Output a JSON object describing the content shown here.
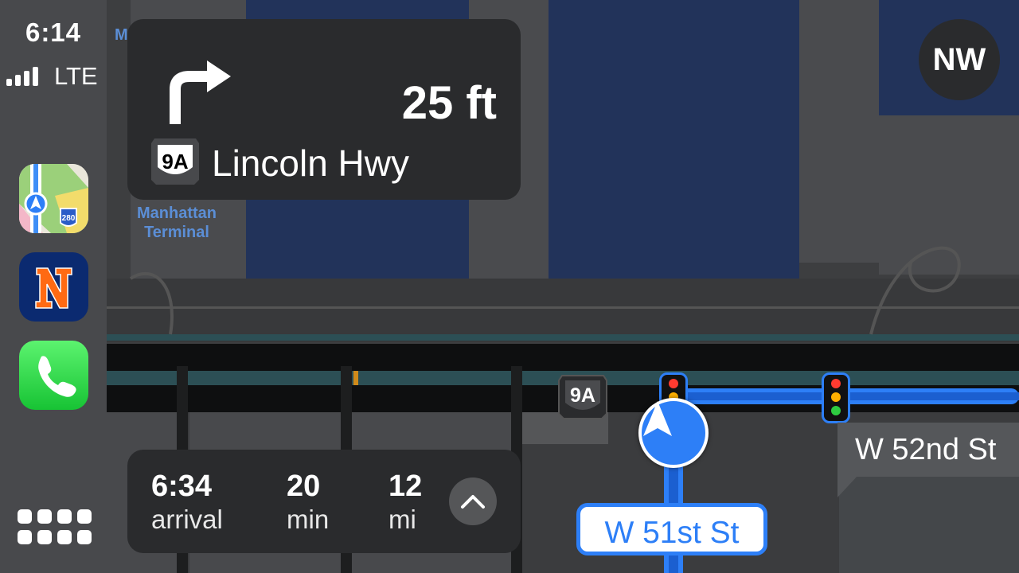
{
  "status_bar": {
    "time": "6:14",
    "network": "LTE",
    "signal_bars": 4
  },
  "dock": {
    "apps": [
      {
        "name": "Maps",
        "badge": "280"
      },
      {
        "name": "Mets"
      },
      {
        "name": "Phone"
      }
    ]
  },
  "maneuver": {
    "distance": "25 ft",
    "route_shield": "9A",
    "road": "Lincoln Hwy",
    "direction": "right"
  },
  "map": {
    "compass": "NW",
    "poi_label": "Manhattan Terminal",
    "poi_partial": "M",
    "road_shield": "9A",
    "current_street": "W 51st St",
    "next_street": "W 52nd St",
    "route_color": "#2d7ff7"
  },
  "trip": {
    "arrival_value": "6:34",
    "arrival_label": "arrival",
    "duration_value": "20",
    "duration_label": "min",
    "distance_value": "12",
    "distance_label": "mi"
  }
}
